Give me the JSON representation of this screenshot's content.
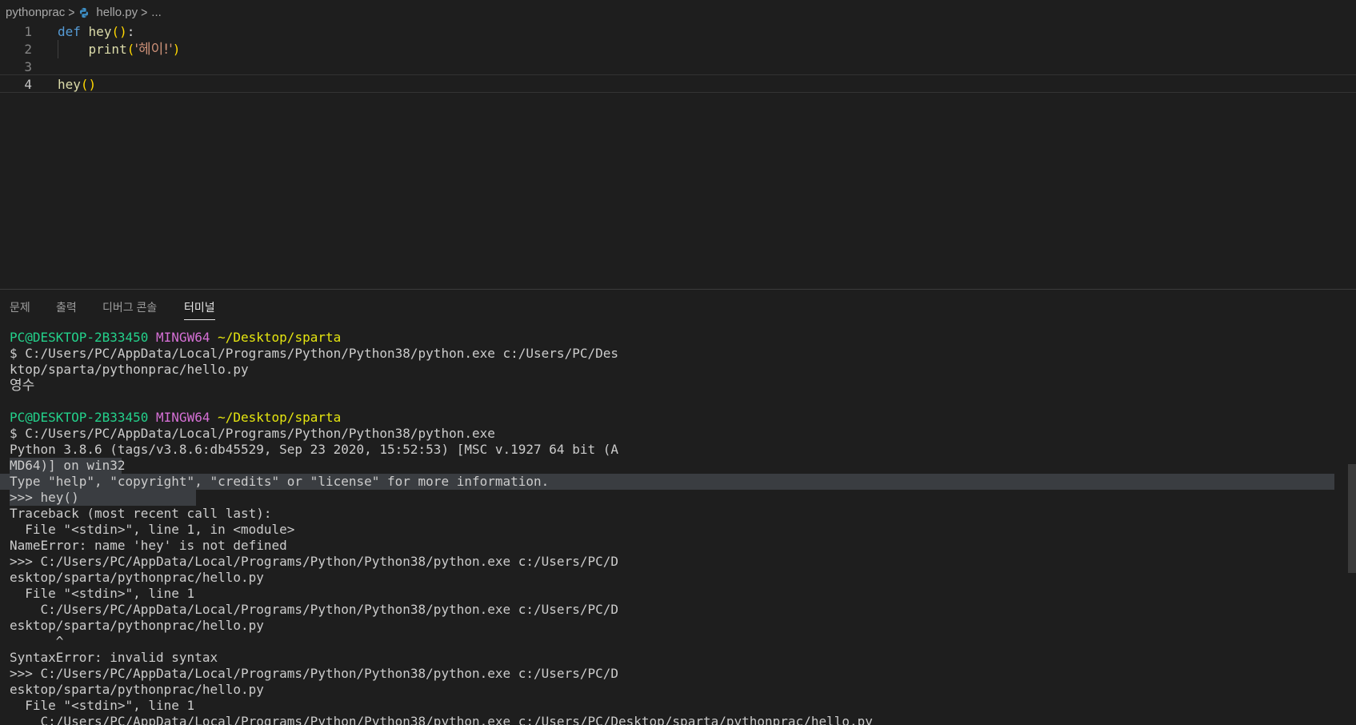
{
  "breadcrumb": {
    "folder": "pythonprac",
    "file": "hello.py",
    "more": "..."
  },
  "editor": {
    "lines": [
      {
        "num": "1",
        "kw": "def",
        "fn": "hey",
        "paren": "()",
        "rest": ":"
      },
      {
        "num": "2",
        "fn": "print",
        "open": "(",
        "str": "'헤이!'",
        "close": ")"
      },
      {
        "num": "3"
      },
      {
        "num": "4",
        "fn": "hey",
        "paren": "()"
      }
    ]
  },
  "panel": {
    "tabs": [
      "문제",
      "출력",
      "디버그 콘솔",
      "터미널"
    ],
    "active_tab": "터미널"
  },
  "terminal": {
    "prompt1": {
      "user": "PC@DESKTOP-2B33450",
      "shell": "MINGW64",
      "path": "~/Desktop/sparta"
    },
    "cmd1a": "$ C:/Users/PC/AppData/Local/Programs/Python/Python38/python.exe c:/Users/PC/Des",
    "cmd1b": "ktop/sparta/pythonprac/hello.py",
    "out1": "영수",
    "prompt2": {
      "user": "PC@DESKTOP-2B33450",
      "shell": "MINGW64",
      "path": "~/Desktop/sparta"
    },
    "cmd2": "$ C:/Users/PC/AppData/Local/Programs/Python/Python38/python.exe",
    "l1": "Python 3.8.6 (tags/v3.8.6:db45529, Sep 23 2020, 15:52:53) [MSC v.1927 64 bit (A",
    "l2": "MD64)] on win32",
    "l3": "Type \"help\", \"copyright\", \"credits\" or \"license\" for more information.",
    "l4": ">>> hey()",
    "l5": "Traceback (most recent call last):",
    "l6": "  File \"<stdin>\", line 1, in <module>",
    "l7": "NameError: name 'hey' is not defined",
    "l8": ">>> C:/Users/PC/AppData/Local/Programs/Python/Python38/python.exe c:/Users/PC/D",
    "l9": "esktop/sparta/pythonprac/hello.py",
    "l10": "  File \"<stdin>\", line 1",
    "l11": "    C:/Users/PC/AppData/Local/Programs/Python/Python38/python.exe c:/Users/PC/D",
    "l12": "esktop/sparta/pythonprac/hello.py",
    "l13": "      ^",
    "l14": "SyntaxError: invalid syntax",
    "l15": ">>> C:/Users/PC/AppData/Local/Programs/Python/Python38/python.exe c:/Users/PC/D",
    "l16": "esktop/sparta/pythonprac/hello.py",
    "l17": "  File \"<stdin>\", line 1",
    "l18": "    C:/Users/PC/AppData/Local/Programs/Python/Python38/python.exe c:/Users/PC/Desktop/sparta/pythonprac/hello.py"
  },
  "colors": {
    "background": "#1e1e1e",
    "keyword": "#569cd6",
    "function": "#dcdcaa",
    "bracket": "#ffd700",
    "string": "#ce9178",
    "terminal_green": "#23d18b",
    "terminal_magenta": "#d670d6",
    "terminal_yellow": "#e5e510"
  }
}
